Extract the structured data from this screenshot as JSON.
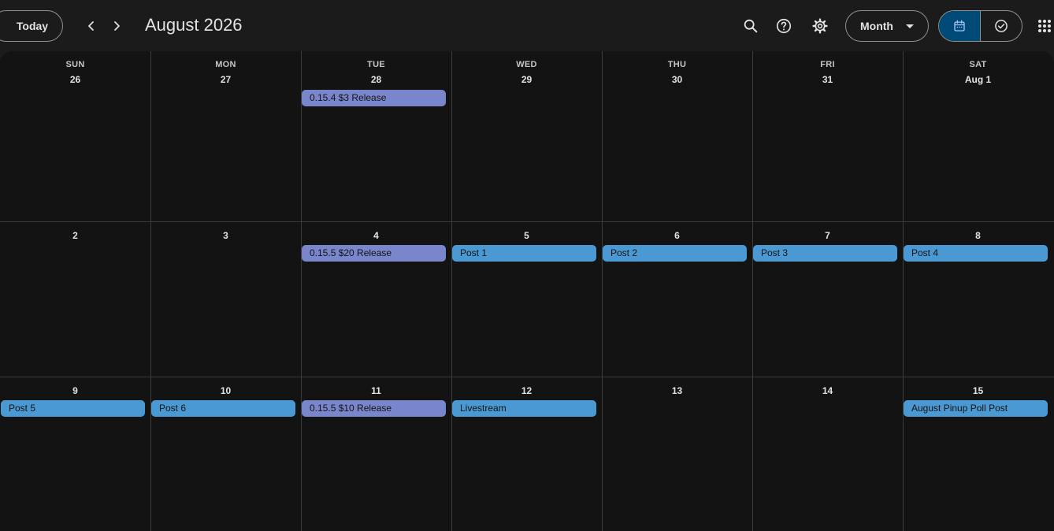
{
  "header": {
    "today_label": "Today",
    "month_title": "August 2026",
    "view_label": "Month"
  },
  "icons": {
    "prev": "chevron-left-icon",
    "next": "chevron-right-icon",
    "search": "search-icon",
    "help": "help-icon",
    "settings": "gear-icon",
    "view_caret": "caret-down-icon",
    "calendar": "calendar-icon",
    "tasks": "task-check-icon",
    "apps": "apps-grid-icon"
  },
  "colors": {
    "release_event": "#7986cb",
    "post_event": "#4a99d3",
    "active_toggle": "#004a77"
  },
  "weekdays": [
    "SUN",
    "MON",
    "TUE",
    "WED",
    "THU",
    "FRI",
    "SAT"
  ],
  "weeks": [
    {
      "days": [
        "26",
        "27",
        "28",
        "29",
        "30",
        "31",
        "Aug 1"
      ],
      "events": [
        {
          "day": 2,
          "label": "0.15.4 $3 Release",
          "kind": "release"
        }
      ]
    },
    {
      "days": [
        "2",
        "3",
        "4",
        "5",
        "6",
        "7",
        "8"
      ],
      "events": [
        {
          "day": 2,
          "label": "0.15.5 $20 Release",
          "kind": "release"
        },
        {
          "day": 3,
          "label": "Post 1",
          "kind": "post"
        },
        {
          "day": 4,
          "label": "Post 2",
          "kind": "post"
        },
        {
          "day": 5,
          "label": "Post 3",
          "kind": "post"
        },
        {
          "day": 6,
          "label": "Post 4",
          "kind": "post"
        }
      ]
    },
    {
      "days": [
        "9",
        "10",
        "11",
        "12",
        "13",
        "14",
        "15"
      ],
      "events": [
        {
          "day": 0,
          "label": "Post 5",
          "kind": "post"
        },
        {
          "day": 1,
          "label": "Post 6",
          "kind": "post"
        },
        {
          "day": 2,
          "label": "0.15.5 $10 Release",
          "kind": "release"
        },
        {
          "day": 3,
          "label": "Livestream",
          "kind": "post"
        },
        {
          "day": 6,
          "label": "August Pinup Poll Post",
          "kind": "post"
        }
      ]
    }
  ]
}
